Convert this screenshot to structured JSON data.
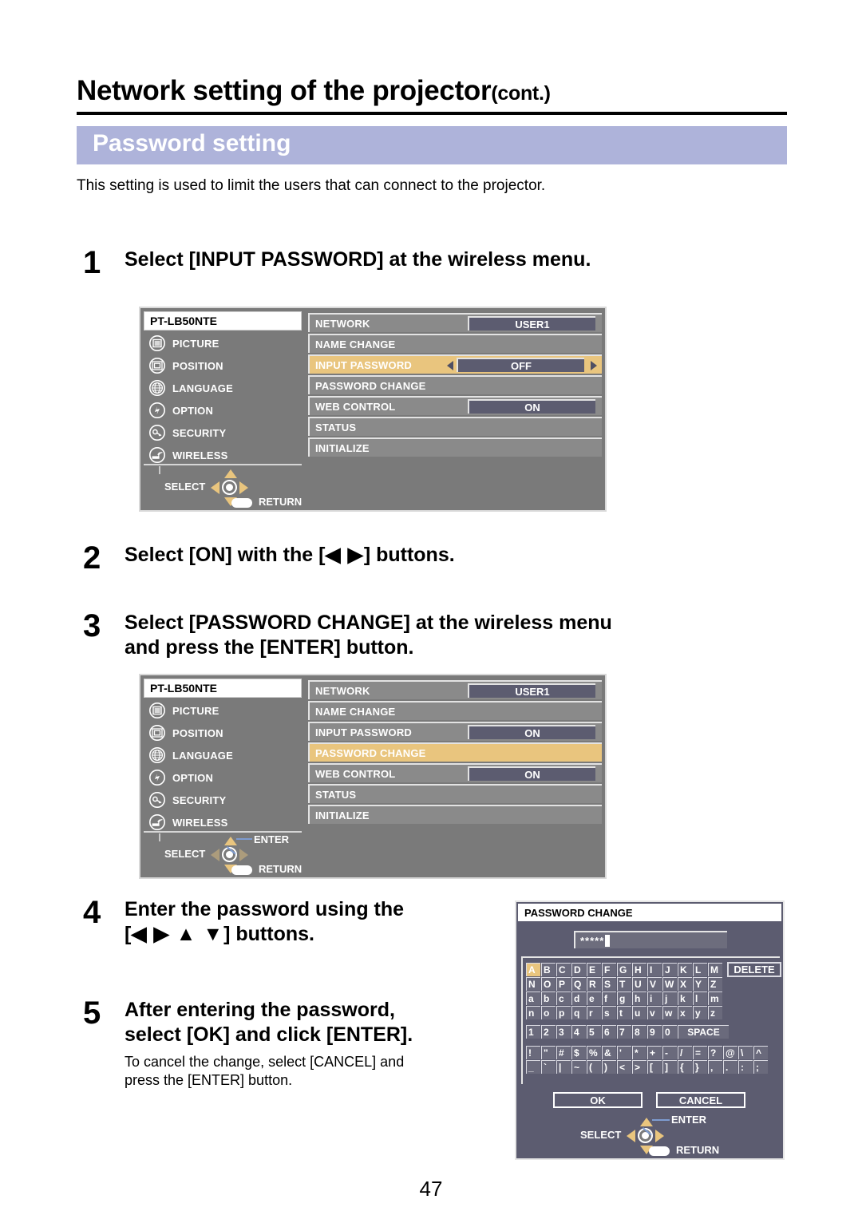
{
  "document": {
    "title_main": "Network setting of the projector",
    "title_cont": "(cont.)",
    "section_title": "Password setting",
    "intro": "This setting is used to limit the users that can connect to the projector.",
    "page_number": "47"
  },
  "colors": {
    "section_band": "#aeb3da",
    "osd_background": "#7a7a7a",
    "osd_item": "#8a8a8a",
    "highlight": "#e9c57e",
    "value_box": "#5c5c70",
    "dialog_background": "#5c5c70",
    "arrow_gold": "#e9c57e",
    "leader_blue": "#7d9bd0"
  },
  "steps": [
    {
      "number": "1",
      "text": "Select [INPUT PASSWORD] at the wireless menu."
    },
    {
      "number": "2",
      "text_before": "Select [ON] with the [",
      "arrows": "◀ ▶",
      "text_after": "] buttons."
    },
    {
      "number": "3",
      "line1": "Select [PASSWORD CHANGE] at the wireless menu",
      "line2": "and press the [ENTER] button."
    },
    {
      "number": "4",
      "line1": "Enter the password using the",
      "line2_before": "[",
      "arrows": "◀ ▶ ▲ ▼",
      "line2_after": "] buttons."
    },
    {
      "number": "5",
      "line1": "After entering the password,",
      "line2": "select [OK] and click [ENTER].",
      "note_line1": "To cancel the change, select [CANCEL] and",
      "note_line2": "press the [ENTER] button."
    }
  ],
  "osd1": {
    "model": "PT-LB50NTE",
    "sidebar": [
      {
        "label": "PICTURE",
        "icon": "picture-icon"
      },
      {
        "label": "POSITION",
        "icon": "position-icon"
      },
      {
        "label": "LANGUAGE",
        "icon": "globe-icon"
      },
      {
        "label": "OPTION",
        "icon": "option-icon"
      },
      {
        "label": "SECURITY",
        "icon": "key-icon"
      },
      {
        "label": "WIRELESS",
        "icon": "wireless-icon"
      }
    ],
    "items": [
      {
        "label": "NETWORK",
        "value": "USER1",
        "highlight": false,
        "arrows": false
      },
      {
        "label": "NAME CHANGE",
        "value": "",
        "highlight": false,
        "arrows": false
      },
      {
        "label": "INPUT PASSWORD",
        "value": "OFF",
        "highlight": true,
        "arrows": true
      },
      {
        "label": "PASSWORD CHANGE",
        "value": "",
        "highlight": false,
        "arrows": false
      },
      {
        "label": "WEB CONTROL",
        "value": "ON",
        "highlight": false,
        "arrows": false
      },
      {
        "label": "STATUS",
        "value": "",
        "highlight": false,
        "arrows": false
      },
      {
        "label": "INITIALIZE",
        "value": "",
        "highlight": false,
        "arrows": false
      }
    ],
    "controls": {
      "select": "SELECT",
      "return": "RETURN",
      "enter": ""
    }
  },
  "osd2": {
    "model": "PT-LB50NTE",
    "sidebar": [
      {
        "label": "PICTURE",
        "icon": "picture-icon"
      },
      {
        "label": "POSITION",
        "icon": "position-icon"
      },
      {
        "label": "LANGUAGE",
        "icon": "globe-icon"
      },
      {
        "label": "OPTION",
        "icon": "option-icon"
      },
      {
        "label": "SECURITY",
        "icon": "key-icon"
      },
      {
        "label": "WIRELESS",
        "icon": "wireless-icon"
      }
    ],
    "items": [
      {
        "label": "NETWORK",
        "value": "USER1",
        "highlight": false,
        "arrows": false
      },
      {
        "label": "NAME CHANGE",
        "value": "",
        "highlight": false,
        "arrows": false
      },
      {
        "label": "INPUT PASSWORD",
        "value": "ON",
        "highlight": false,
        "arrows": false
      },
      {
        "label": "PASSWORD CHANGE",
        "value": "",
        "highlight": true,
        "arrows": false
      },
      {
        "label": "WEB CONTROL",
        "value": "ON",
        "highlight": false,
        "arrows": false
      },
      {
        "label": "STATUS",
        "value": "",
        "highlight": false,
        "arrows": false
      },
      {
        "label": "INITIALIZE",
        "value": "",
        "highlight": false,
        "arrows": false
      }
    ],
    "controls": {
      "select": "SELECT",
      "return": "RETURN",
      "enter": "ENTER"
    }
  },
  "password_dialog": {
    "title": "PASSWORD CHANGE",
    "field_value": "*****",
    "keyboard_rows": [
      [
        "A",
        "B",
        "C",
        "D",
        "E",
        "F",
        "G",
        "H",
        "I",
        "J",
        "K",
        "L",
        "M"
      ],
      [
        "N",
        "O",
        "P",
        "Q",
        "R",
        "S",
        "T",
        "U",
        "V",
        "W",
        "X",
        "Y",
        "Z"
      ],
      [
        "a",
        "b",
        "c",
        "d",
        "e",
        "f",
        "g",
        "h",
        "i",
        "j",
        "k",
        "l",
        "m"
      ],
      [
        "n",
        "o",
        "p",
        "q",
        "r",
        "s",
        "t",
        "u",
        "v",
        "w",
        "x",
        "y",
        "z"
      ],
      [
        "1",
        "2",
        "3",
        "4",
        "5",
        "6",
        "7",
        "8",
        "9",
        "0"
      ],
      [
        "!",
        "\"",
        "#",
        "$",
        "%",
        "&",
        "'",
        "*",
        "+",
        "-",
        "/",
        "=",
        "?",
        "@",
        "\\",
        "^"
      ],
      [
        "_",
        "`",
        "|",
        "~",
        "(",
        ")",
        "<",
        ">",
        "[",
        "]",
        "{",
        "}",
        ",",
        ".",
        ":",
        ";"
      ]
    ],
    "selected_key": "A",
    "space_label": "SPACE",
    "delete_label": "DELETE",
    "ok_label": "OK",
    "cancel_label": "CANCEL",
    "controls": {
      "select": "SELECT",
      "enter": "ENTER",
      "return": "RETURN"
    }
  }
}
